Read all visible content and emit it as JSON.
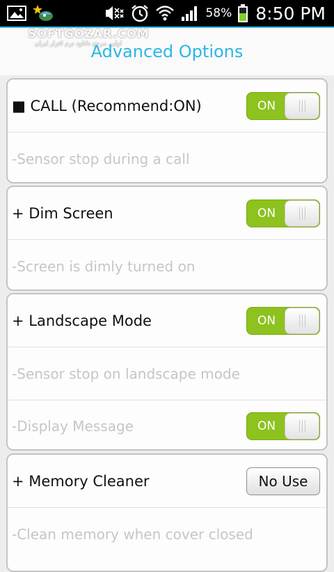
{
  "status_bar": {
    "icons_left": [
      "gallery-icon",
      "game-notification-icon"
    ],
    "icons_right": [
      "silent-mode-icon",
      "alarm-icon",
      "wifi-icon",
      "signal-icon"
    ],
    "battery_percent": "58%",
    "battery_level": 0.58,
    "time": "8:50 PM"
  },
  "watermark": {
    "main": "SOFTGOZAR.COM",
    "sub": "اولین مرجع دانلود نرم افزار ایران"
  },
  "title": "Advanced Options",
  "colors": {
    "title": "#2bb6e6",
    "accent_line": "#2db5e3",
    "toggle_on": "#8dc21f",
    "subtext": "#c6c6c6"
  },
  "cards": {
    "call": {
      "label": "■ CALL (Recommend:ON)",
      "toggle": "ON",
      "description": "-Sensor stop during a call"
    },
    "dim": {
      "label": "+ Dim Screen",
      "toggle": "ON",
      "description": "-Screen is dimly turned on"
    },
    "landscape": {
      "label": "+ Landscape Mode",
      "toggle": "ON",
      "description": "-Sensor stop on landscape mode",
      "display_label": "-Display Message",
      "display_toggle": "ON"
    },
    "memory": {
      "label": "+ Memory Cleaner",
      "button": "No Use",
      "description": "-Clean memory when cover closed"
    }
  }
}
